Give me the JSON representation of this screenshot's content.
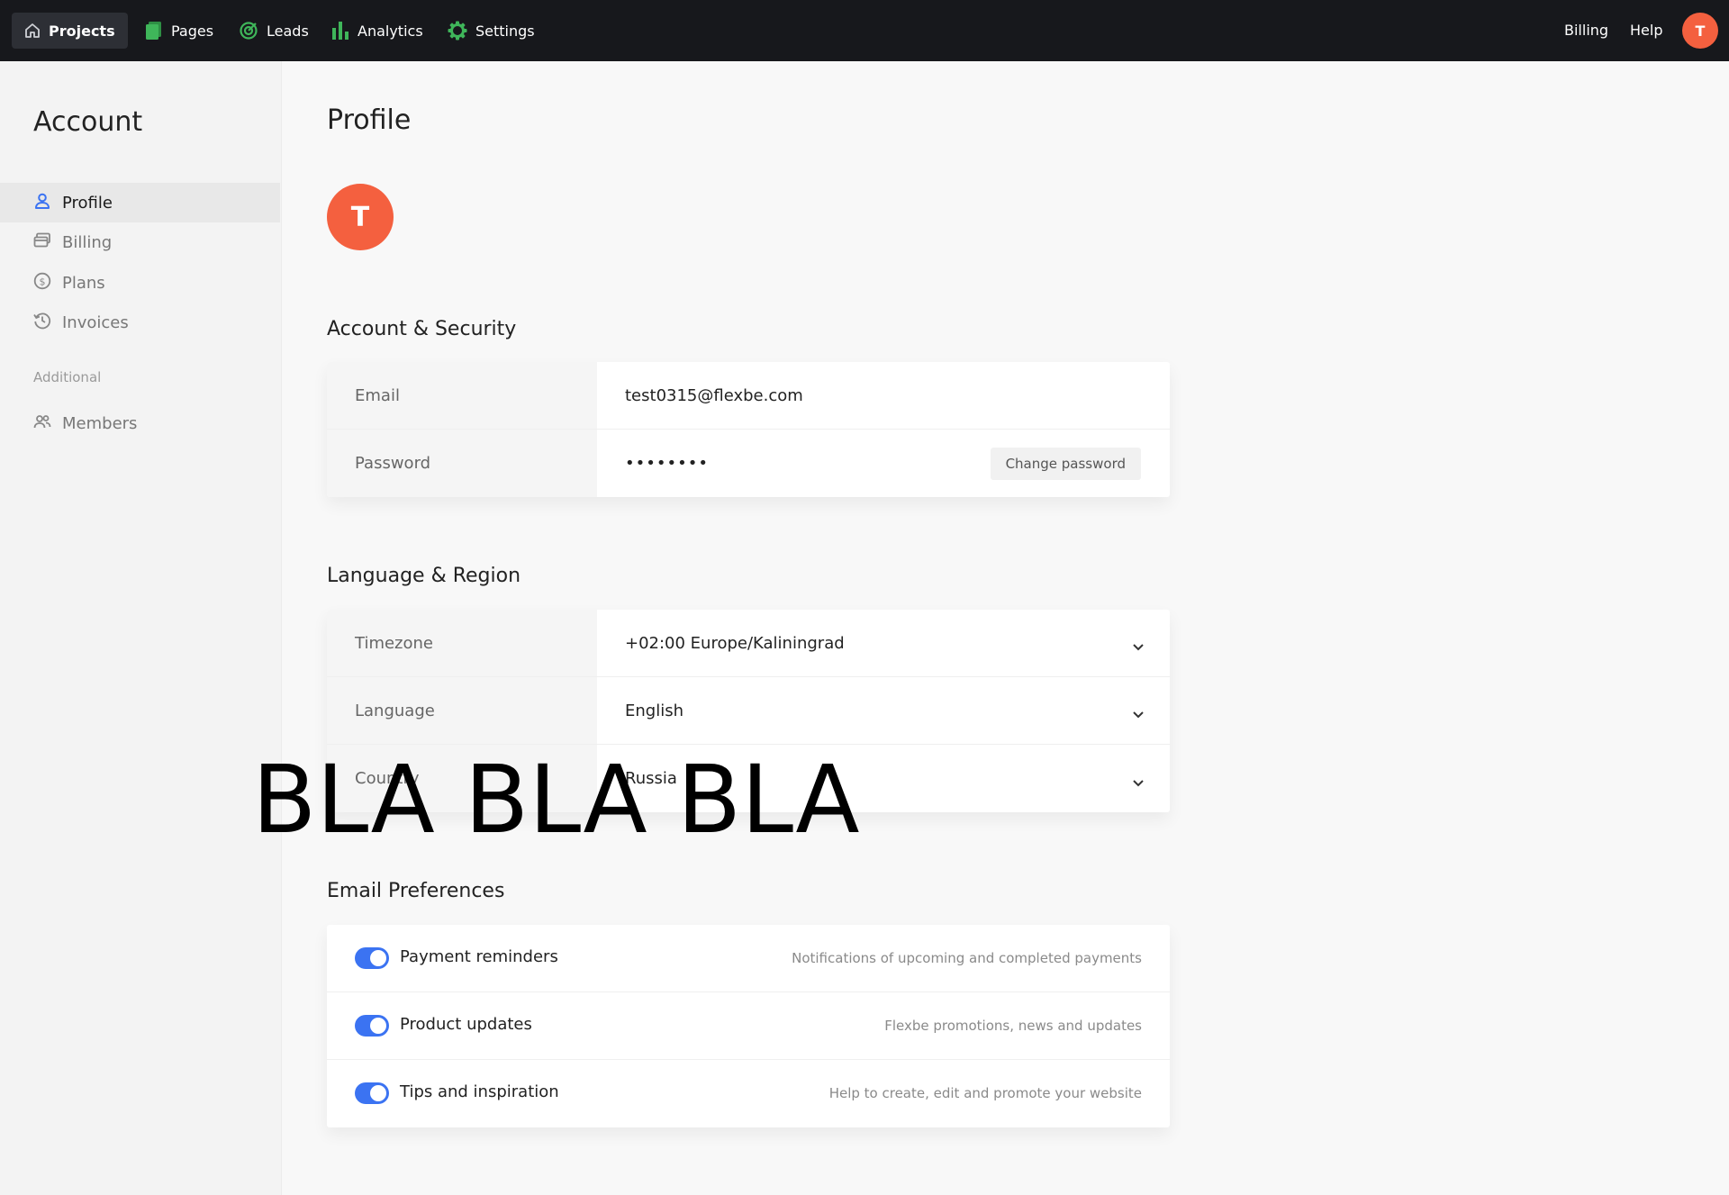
{
  "topbar": {
    "nav": [
      {
        "label": "Projects",
        "icon": "home-icon"
      },
      {
        "label": "Pages",
        "icon": "pages-icon"
      },
      {
        "label": "Leads",
        "icon": "target-icon"
      },
      {
        "label": "Analytics",
        "icon": "bar-chart-icon"
      },
      {
        "label": "Settings",
        "icon": "gear-icon"
      }
    ],
    "billing": "Billing",
    "help": "Help",
    "avatar_letter": "T"
  },
  "sidebar": {
    "title": "Account",
    "items": [
      {
        "label": "Profile",
        "icon": "user-icon"
      },
      {
        "label": "Billing",
        "icon": "card-icon"
      },
      {
        "label": "Plans",
        "icon": "dollar-icon"
      },
      {
        "label": "Invoices",
        "icon": "history-icon"
      }
    ],
    "section": "Additional",
    "extra_items": [
      {
        "label": "Members",
        "icon": "users-icon"
      }
    ]
  },
  "main": {
    "title": "Profile",
    "avatar_letter": "T",
    "security": {
      "title": "Account & Security",
      "email_label": "Email",
      "email_value": "test0315@flexbe.com",
      "password_label": "Password",
      "password_value": "••••••••",
      "change_password": "Change password"
    },
    "region": {
      "title": "Language & Region",
      "timezone_label": "Timezone",
      "timezone_value": "+02:00 Europe/Kaliningrad",
      "language_label": "Language",
      "language_value": "English",
      "country_label": "Country",
      "country_value": "Russia"
    },
    "prefs": {
      "title": "Email Preferences",
      "items": [
        {
          "label": "Payment reminders",
          "desc": "Notifications of upcoming and completed payments",
          "enabled": true
        },
        {
          "label": "Product updates",
          "desc": "Flexbe promotions, news and updates",
          "enabled": true
        },
        {
          "label": "Tips and inspiration",
          "desc": "Help to create, edit and promote your website",
          "enabled": true
        }
      ]
    }
  },
  "overlay_text": "BLA BLA BLA",
  "colors": {
    "topbar": "#17181c",
    "accent": "#3b73f2",
    "avatar": "#f4603f",
    "nav_icon": "#3fb65a"
  }
}
